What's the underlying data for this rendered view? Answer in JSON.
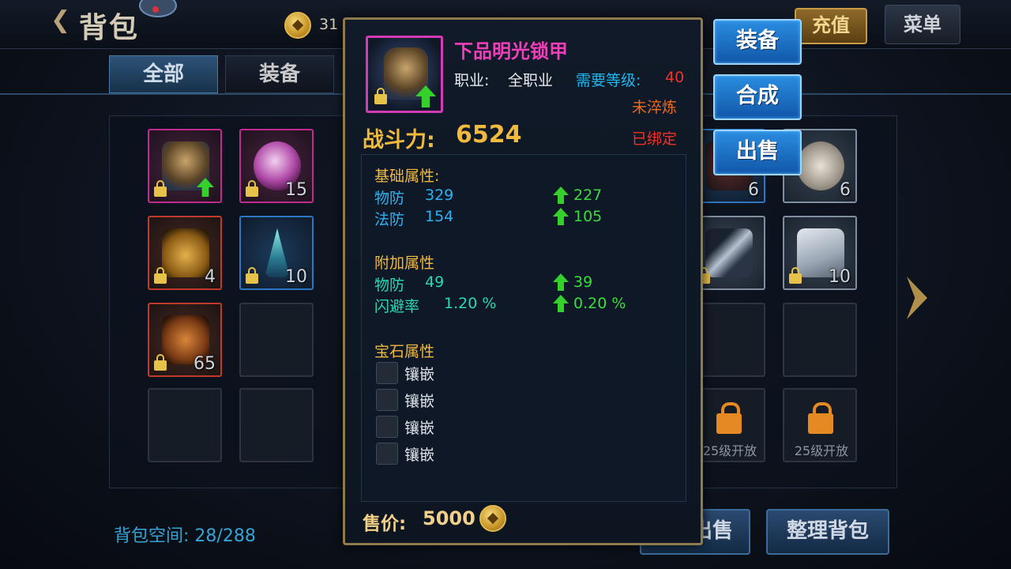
{
  "header": {
    "title": "背包",
    "currency_amount": "31",
    "recharge_label": "充值",
    "menu_label": "菜单"
  },
  "tabs": [
    {
      "label": "全部",
      "active": true
    },
    {
      "label": "装备",
      "active": false
    }
  ],
  "grid": {
    "slots": [
      {
        "icon": "armor-icon",
        "quality": "purple",
        "count": "",
        "locked": true,
        "upgrade": true
      },
      {
        "icon": "orb-icon",
        "quality": "purple",
        "count": "15",
        "locked": true
      },
      {
        "icon": "vase-icon",
        "quality": "red",
        "count": "4",
        "locked": true
      },
      {
        "icon": "crystal-icon",
        "quality": "blue",
        "count": "10",
        "locked": true
      },
      {
        "icon": "boots-icon",
        "quality": "red",
        "count": "65",
        "locked": true
      },
      {
        "icon": "item-icon",
        "quality": "blue",
        "count": "6"
      },
      {
        "icon": "scroll-icon",
        "quality": "grey",
        "count": "6"
      },
      {
        "icon": "blade-icon",
        "quality": "grey",
        "count": "",
        "locked": true
      },
      {
        "icon": "paper-icon",
        "quality": "grey",
        "count": "10",
        "locked": true
      }
    ],
    "unlock_labels": [
      "25级开放",
      "25级开放"
    ]
  },
  "footer": {
    "bag_space_label": "背包空间:",
    "bag_space_value": "28/288",
    "sell_label": "出售",
    "tidy_label": "整理背包"
  },
  "tooltip": {
    "name": "下品明光锁甲",
    "class_label": "职业:",
    "class_value": "全职业",
    "level_label": "需要等级:",
    "level_value": "40",
    "refine_status": "未淬炼",
    "power_label": "战斗力:",
    "power_value": "6524",
    "bound_status": "已绑定",
    "base_title": "基础属性:",
    "base_attrs": [
      {
        "name": "物防",
        "value": "329",
        "bonus": "227"
      },
      {
        "name": "法防",
        "value": "154",
        "bonus": "105"
      }
    ],
    "extra_title": "附加属性",
    "extra_attrs": [
      {
        "name": "物防",
        "value": "49",
        "bonus": "39"
      },
      {
        "name": "闪避率",
        "value": "1.20 %",
        "bonus": "0.20 %"
      }
    ],
    "gem_title": "宝石属性",
    "sockets": [
      "镶嵌",
      "镶嵌",
      "镶嵌",
      "镶嵌"
    ],
    "price_label": "售价:",
    "price_value": "5000"
  },
  "actions": {
    "equip": "装备",
    "compose": "合成",
    "sell": "出售"
  },
  "colors": {
    "accent_gold": "#f2b93f",
    "item_name_purple": "#ef3fb9",
    "upgrade_green": "#36d02d",
    "button_blue": "#1f76cc"
  }
}
